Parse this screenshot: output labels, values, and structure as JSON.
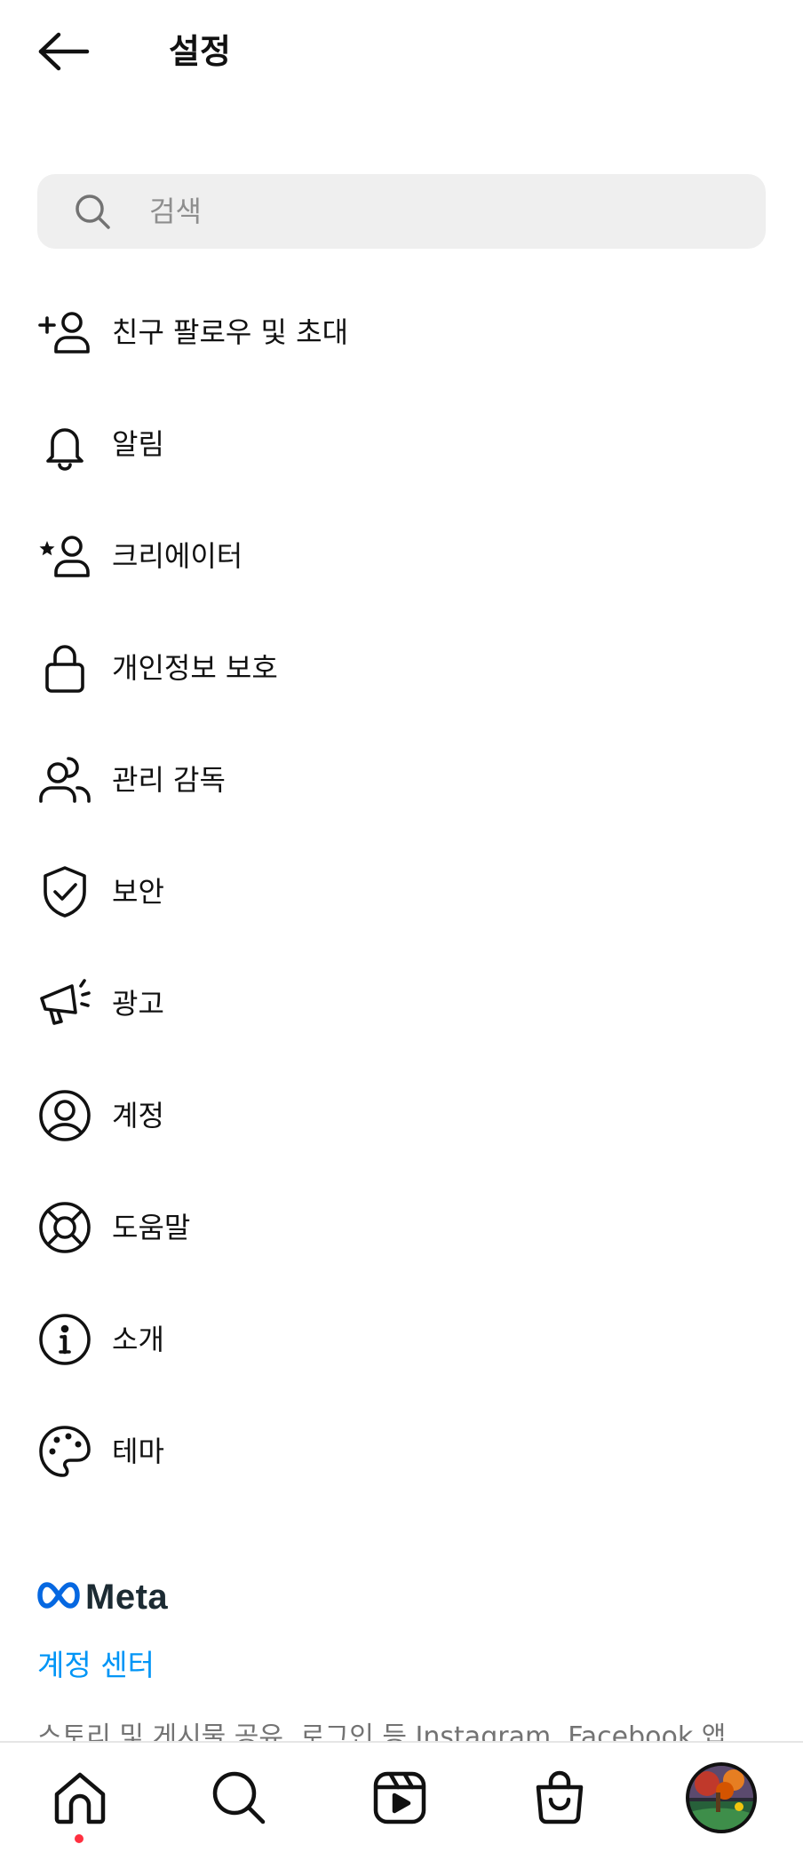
{
  "header": {
    "title": "설정",
    "back_icon": "arrow-left-icon"
  },
  "search": {
    "placeholder": "검색",
    "value": ""
  },
  "menu": {
    "items": [
      {
        "label": "친구 팔로우 및 초대",
        "icon": "person-add-icon"
      },
      {
        "label": "알림",
        "icon": "bell-icon"
      },
      {
        "label": "크리에이터",
        "icon": "person-star-icon"
      },
      {
        "label": "개인정보 보호",
        "icon": "lock-icon"
      },
      {
        "label": "관리 감독",
        "icon": "people-icon"
      },
      {
        "label": "보안",
        "icon": "shield-check-icon"
      },
      {
        "label": "광고",
        "icon": "megaphone-icon"
      },
      {
        "label": "계정",
        "icon": "account-circle-icon"
      },
      {
        "label": "도움말",
        "icon": "lifebuoy-icon"
      },
      {
        "label": "소개",
        "icon": "info-icon"
      },
      {
        "label": "테마",
        "icon": "palette-icon"
      }
    ]
  },
  "meta": {
    "logo_text": "Meta",
    "account_center_label": "계정 센터",
    "description": "스토리 및 게시물 공유, 로그인 등 Instagram, Facebook 앱"
  },
  "bottom_nav": {
    "items": [
      "home-icon",
      "search-icon",
      "reels-icon",
      "shop-bag-icon",
      "profile-avatar"
    ],
    "notification_color": "#ff3040"
  },
  "colors": {
    "accent": "#0095f6",
    "search_bg": "#efefef",
    "text": "#111111",
    "meta_blue": "#0668e1"
  }
}
